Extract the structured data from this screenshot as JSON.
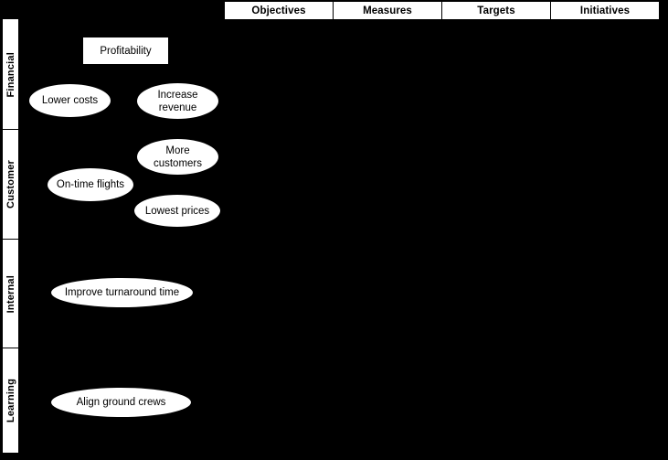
{
  "header": {
    "columns": [
      {
        "label": "Objectives"
      },
      {
        "label": "Measures"
      },
      {
        "label": "Targets"
      },
      {
        "label": "Initiatives"
      }
    ]
  },
  "sidebar": {
    "perspectives": [
      {
        "label": "Financial"
      },
      {
        "label": "Customer"
      },
      {
        "label": "Internal"
      },
      {
        "label": "Learning"
      }
    ]
  },
  "strategy_map": {
    "nodes": [
      {
        "label": "Profitability",
        "shape": "rect",
        "perspective": "Financial"
      },
      {
        "label": "Lower costs",
        "shape": "ellipse",
        "perspective": "Financial"
      },
      {
        "label": "Increase revenue",
        "shape": "ellipse",
        "perspective": "Financial"
      },
      {
        "label": "More customers",
        "shape": "ellipse",
        "perspective": "Customer"
      },
      {
        "label": "On-time flights",
        "shape": "ellipse",
        "perspective": "Customer"
      },
      {
        "label": "Lowest prices",
        "shape": "ellipse",
        "perspective": "Customer"
      },
      {
        "label": "Improve turnaround time",
        "shape": "ellipse",
        "perspective": "Internal"
      },
      {
        "label": "Align ground crews",
        "shape": "ellipse",
        "perspective": "Learning"
      }
    ]
  },
  "colors": {
    "background": "#000000",
    "surface": "#ffffff",
    "stroke": "#000000",
    "text": "#000000"
  }
}
